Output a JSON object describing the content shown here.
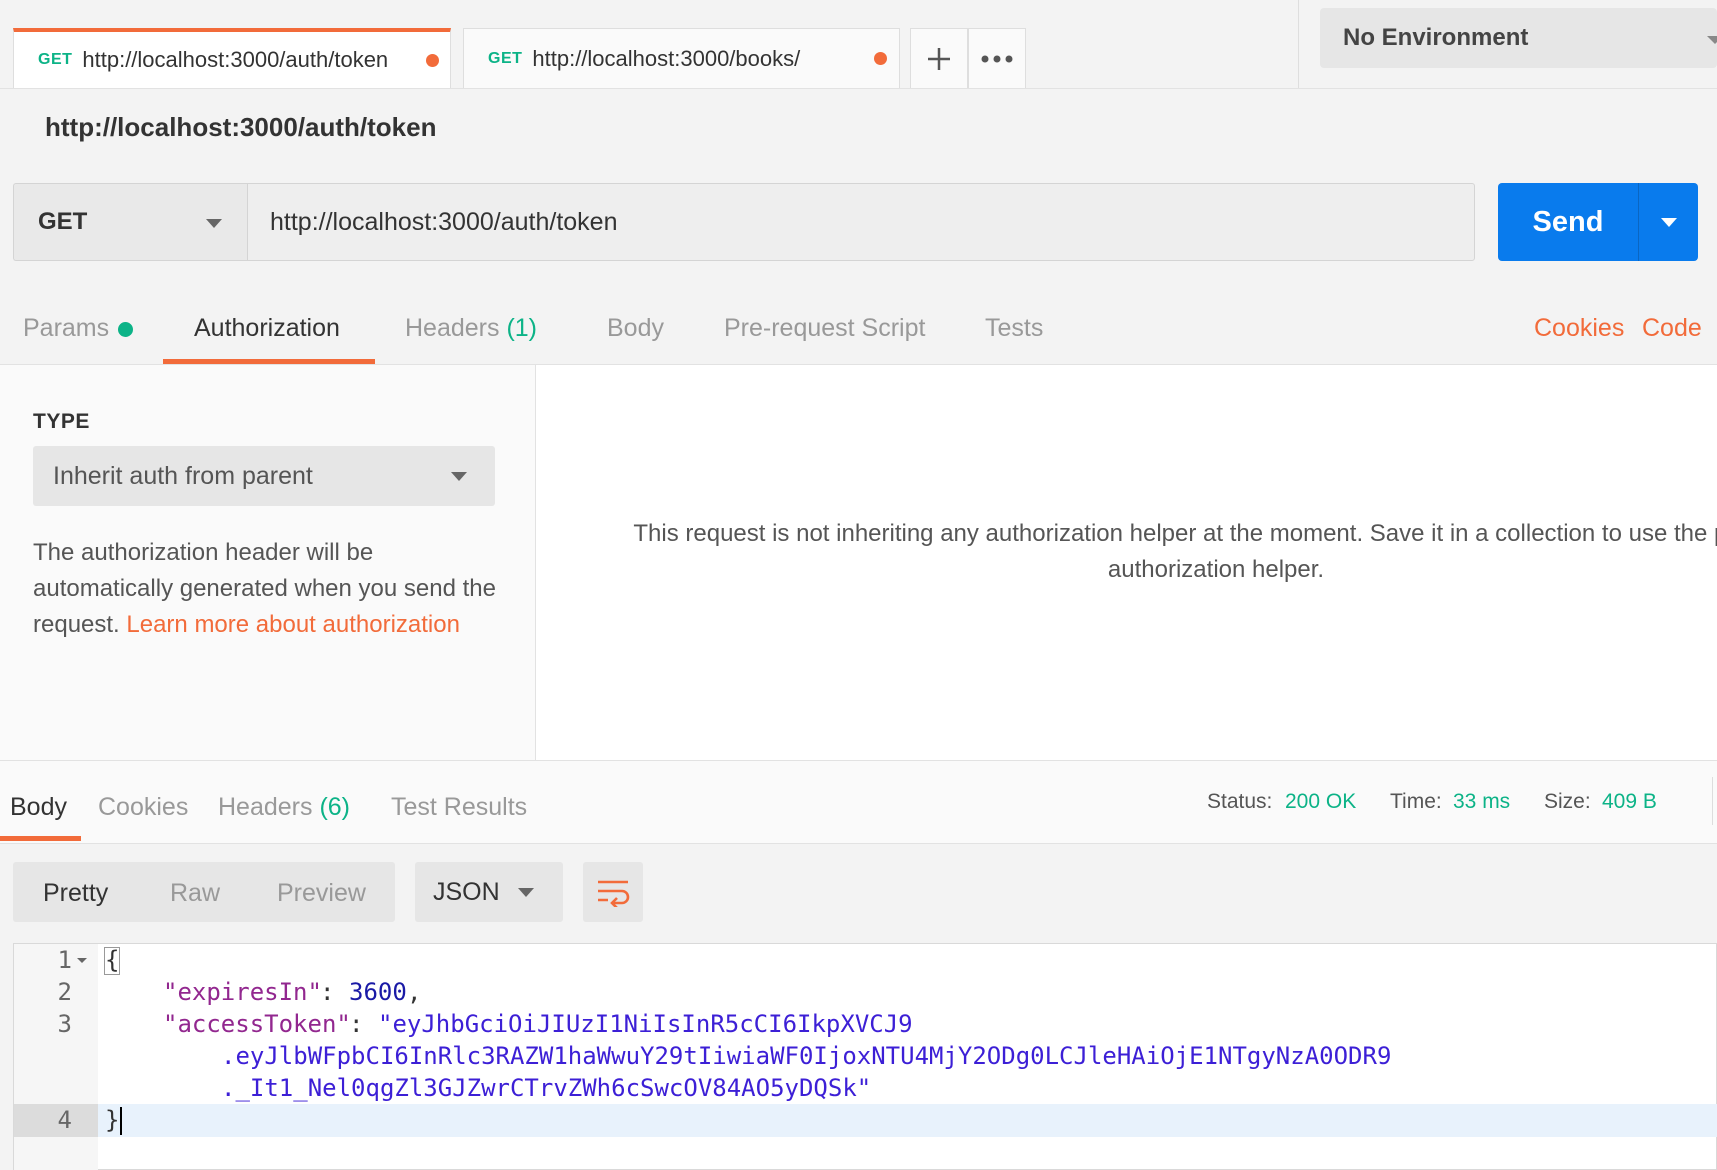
{
  "tabs": [
    {
      "method": "GET",
      "url": "http://localhost:3000/auth/token",
      "active": true
    },
    {
      "method": "GET",
      "url": "http://localhost:3000/books/",
      "active": false
    }
  ],
  "tab_actions": {
    "new_tab_icon": "plus-icon",
    "more_icon": "ellipsis-icon"
  },
  "environment": {
    "selected": "No Environment"
  },
  "request": {
    "title": "http://localhost:3000/auth/token",
    "method": "GET",
    "url": "http://localhost:3000/auth/token",
    "send_label": "Send"
  },
  "request_tabs": {
    "params": "Params",
    "authorization": "Authorization",
    "headers": "Headers",
    "headers_count": "(1)",
    "body": "Body",
    "pre_request": "Pre-request Script",
    "tests": "Tests",
    "cookies": "Cookies",
    "code": "Code"
  },
  "auth": {
    "type_label": "TYPE",
    "type_value": "Inherit auth from parent",
    "description": "The authorization header will be automatically generated when you send the request.",
    "learn_more": "Learn more about authorization",
    "message": "This request is not inheriting any authorization helper at the moment. Save it in a collection to use the parent's authorization helper."
  },
  "response": {
    "tabs": {
      "body": "Body",
      "cookies": "Cookies",
      "headers": "Headers",
      "headers_count": "(6)",
      "test_results": "Test Results"
    },
    "status_label": "Status:",
    "status_value": "200 OK",
    "time_label": "Time:",
    "time_value": "33 ms",
    "size_label": "Size:",
    "size_value": "409 B",
    "views": {
      "pretty": "Pretty",
      "raw": "Raw",
      "preview": "Preview"
    },
    "format": "JSON",
    "wrap_icon": "wrap-lines-icon"
  },
  "body_lines": {
    "ln1": "1",
    "ln2": "2",
    "ln3": "3",
    "ln4": "4",
    "open_brace": "{",
    "close_brace": "}",
    "key1": "\"expiresIn\"",
    "val1": "3600",
    "key2": "\"accessToken\"",
    "val2_a": "\"eyJhbGciOiJIUzI1NiIsInR5cCI6IkpXVCJ9",
    "val2_b": ".eyJlbWFpbCI6InRlc3RAZW1haWwuY29tIiwiaWF0IjoxNTU4MjY2ODg0LCJleHAiOjE1NTgyNzA0ODR9",
    "val2_c": "._It1_Nel0qgZl3GJZwrCTrvZWh6cSwcOV84AO5yDQSk\""
  }
}
